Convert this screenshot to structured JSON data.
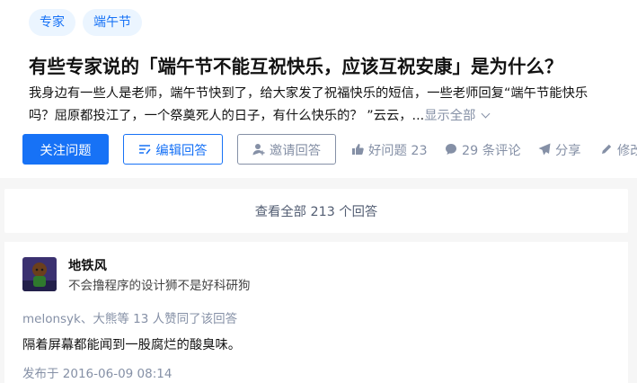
{
  "question": {
    "topics": [
      "专家",
      "端午节"
    ],
    "title": "有些专家说的「端午节不能互祝快乐，应该互祝安康」是为什么？",
    "detail_line1": "我身边有一些人是老师，端午节快到了，给大家发了祝福快乐的短信，一些老师回复“端午节能快乐",
    "detail_line2": "吗？屈原都投江了，一个祭奠死人的日子，有什么快乐的？ ”云云，...",
    "show_all": "显示全部"
  },
  "actions": {
    "follow": "关注问题",
    "edit": "编辑回答",
    "invite": "邀请回答",
    "good_question": "好问题 23",
    "comments": "29 条评论",
    "share": "分享",
    "modify": "修改"
  },
  "view_all": "查看全部 213 个回答",
  "answer": {
    "author": "地铁风",
    "bio": "不会撸程序的设计狮不是好科研狗",
    "votes": "melonsyk、大熊等 13 人赞同了该回答",
    "content": "隔着屏幕都能闻到一股腐烂的酸臭味。",
    "published": "发布于 2016-06-09 08:14"
  },
  "colors": {
    "brand": "#1772f6",
    "muted": "#8590a6",
    "page_bg": "#f6f6f6"
  }
}
